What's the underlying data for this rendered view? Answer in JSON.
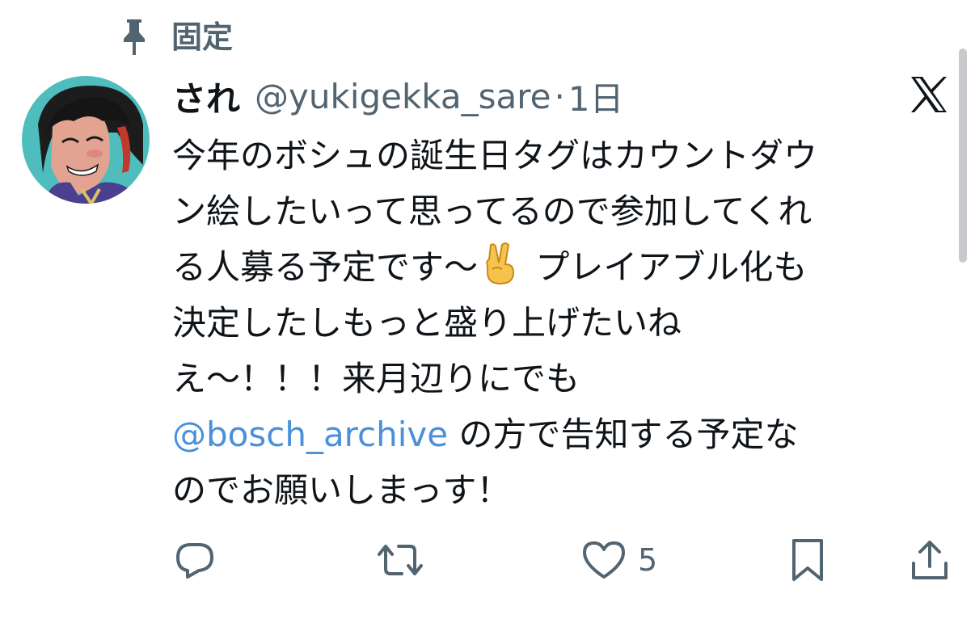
{
  "pinned": {
    "label": "固定",
    "icon": "pin-icon"
  },
  "tweet": {
    "display_name": "され",
    "handle": "@yukigekka_sare",
    "separator": "·",
    "time": "1日",
    "platform_icon": "x-logo-icon",
    "text_lines": [
      {
        "text": "今年のボシュの誕生日タグはカウントダウ"
      },
      {
        "text": "ン絵したいって思ってるので参加してくれ"
      },
      {
        "before": "る人募る予定です〜",
        "emoji": "victory-hand-emoji",
        "after": " プレイアブル化も"
      },
      {
        "text": "決定したしもっと盛り上げたいね"
      },
      {
        "text": "え〜！！！来月辺りにでも"
      },
      {
        "mention": "@bosch_archive",
        "after": " の方で告知する予定な"
      },
      {
        "text": "のでお願いしまっす！"
      }
    ],
    "actions": {
      "reply_icon": "reply-icon",
      "retweet_icon": "retweet-icon",
      "like_icon": "heart-icon",
      "like_count": "5",
      "bookmark_icon": "bookmark-icon",
      "share_icon": "share-icon"
    }
  },
  "colors": {
    "text_primary": "#0f1419",
    "text_secondary": "#536471",
    "mention": "#4a90d9",
    "background": "#ffffff"
  }
}
